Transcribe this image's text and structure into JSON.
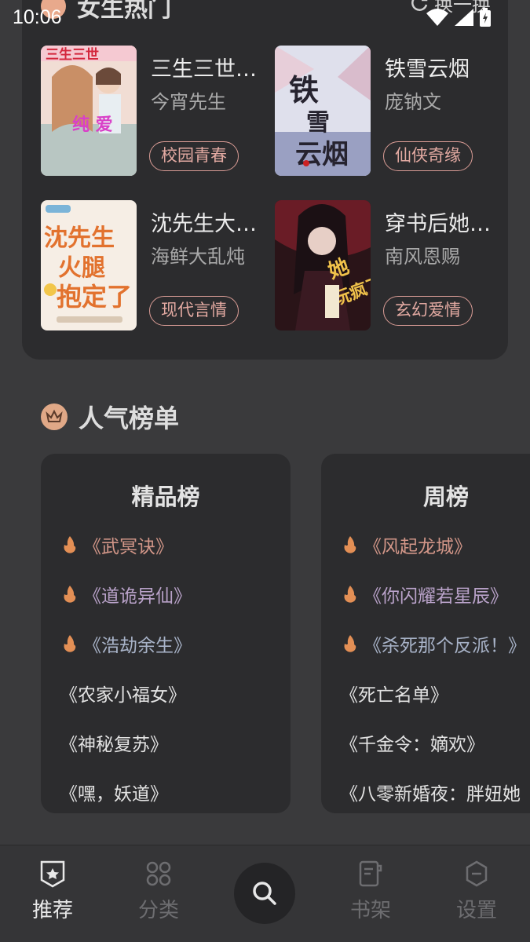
{
  "status": {
    "time": "10:06"
  },
  "hot": {
    "title": "女生热门",
    "refresh_label": "换一换",
    "books": [
      {
        "title": "三生三世…",
        "author": "今宵先生",
        "tag": "校园青春",
        "cover_colors": [
          "#f2d9cf",
          "#c8a7b4"
        ],
        "cover_text": "三生三世"
      },
      {
        "title": "铁雪云烟",
        "author": "庞钠文",
        "tag": "仙侠奇缘",
        "cover_colors": [
          "#e4e5ee",
          "#a5a9c4"
        ],
        "cover_text": "铁雪云烟"
      },
      {
        "title": "沈先生大…",
        "author": "海鲜大乱炖",
        "tag": "现代言情",
        "cover_colors": [
          "#f6ece1",
          "#e3c9a8"
        ],
        "cover_text": "沈先生火腿抱定了"
      },
      {
        "title": "穿书后她…",
        "author": "南风恩赐",
        "tag": "玄幻爱情",
        "cover_colors": [
          "#5a1a22",
          "#1e1216"
        ],
        "cover_text": "她玩疯了"
      }
    ]
  },
  "rank": {
    "title": "人气榜单",
    "boards": [
      {
        "title": "精品榜",
        "items": [
          "《武冥诀》",
          "《道诡异仙》",
          "《浩劫余生》",
          "《农家小福女》",
          "《神秘复苏》",
          "《嘿，妖道》"
        ]
      },
      {
        "title": "周榜",
        "items": [
          "《风起龙城》",
          "《你闪耀若星辰》",
          "《杀死那个反派！》",
          "《死亡名单》",
          "《千金令：嫡欢》",
          "《八零新婚夜：胖妞她"
        ]
      }
    ]
  },
  "nav": {
    "items": [
      {
        "label": "推荐",
        "icon": "recommend-icon"
      },
      {
        "label": "分类",
        "icon": "category-icon"
      },
      {
        "label": "书架",
        "icon": "bookshelf-icon"
      },
      {
        "label": "设置",
        "icon": "settings-icon"
      }
    ],
    "search_icon": "search-icon"
  },
  "colors": {
    "accent": "#e3aaa2",
    "background": "#3a3a3c",
    "card": "#2c2c2e"
  }
}
